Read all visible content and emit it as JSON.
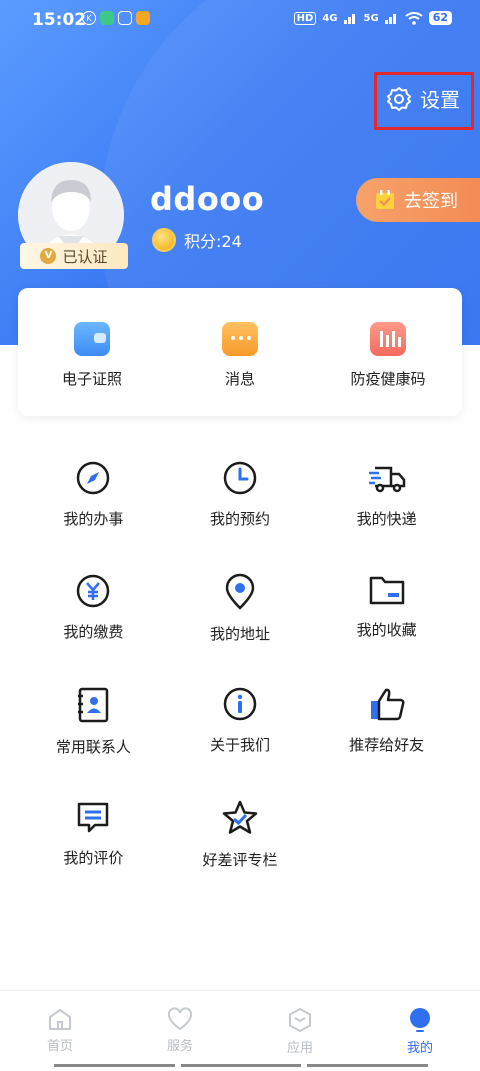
{
  "status_bar": {
    "time": "15:02",
    "network_hd": "HD",
    "net_4g": "4G",
    "net_5g": "5G",
    "battery": "62"
  },
  "header": {
    "settings_label": "设置",
    "username": "ddooo",
    "points_label": "积分:24",
    "verified_label": "已认证",
    "signin_label": "去签到"
  },
  "quick_card": [
    {
      "label": "电子证照",
      "icon": "wallet-icon"
    },
    {
      "label": "消息",
      "icon": "message-icon"
    },
    {
      "label": "防疫健康码",
      "icon": "health-code-icon"
    }
  ],
  "grid": [
    {
      "label": "我的办事",
      "icon": "compass-icon"
    },
    {
      "label": "我的预约",
      "icon": "clock-icon"
    },
    {
      "label": "我的快递",
      "icon": "truck-icon"
    },
    {
      "label": "我的缴费",
      "icon": "yen-icon"
    },
    {
      "label": "我的地址",
      "icon": "location-icon"
    },
    {
      "label": "我的收藏",
      "icon": "folder-icon"
    },
    {
      "label": "常用联系人",
      "icon": "contacts-icon"
    },
    {
      "label": "关于我们",
      "icon": "info-icon"
    },
    {
      "label": "推荐给好友",
      "icon": "thumbs-up-icon"
    },
    {
      "label": "我的评价",
      "icon": "comment-icon"
    },
    {
      "label": "好差评专栏",
      "icon": "star-icon"
    }
  ],
  "tabbar": [
    {
      "label": "首页",
      "icon": "home-icon",
      "active": false
    },
    {
      "label": "服务",
      "icon": "heart-icon",
      "active": false
    },
    {
      "label": "应用",
      "icon": "hexagon-icon",
      "active": false
    },
    {
      "label": "我的",
      "icon": "profile-icon",
      "active": true
    }
  ],
  "colors": {
    "primary": "#2f6ff0",
    "signin": "#f38b55",
    "highlight_box": "#e0282e"
  }
}
